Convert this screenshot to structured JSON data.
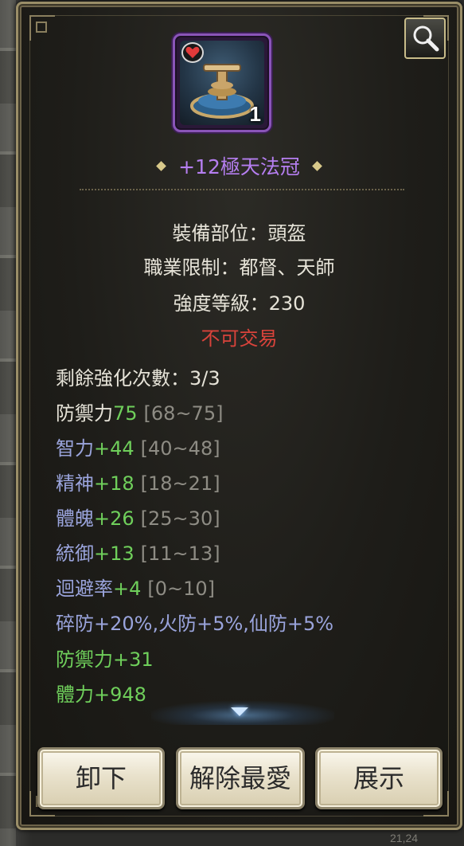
{
  "item": {
    "name": "+12極天法冠",
    "count": "1",
    "slot": "裝備部位：頭盔",
    "class_limit": "職業限制：都督、天師",
    "level": "強度等級：230",
    "trade_status": "不可交易",
    "enhance_remaining": "剩餘強化次數：3/3"
  },
  "stats": [
    {
      "label": "防禦力",
      "value": "75",
      "range": "[68~75]"
    },
    {
      "label": "智力",
      "value": "+44",
      "range": "[40~48]"
    },
    {
      "label": "精神",
      "value": "+18",
      "range": "[18~21]"
    },
    {
      "label": "體魄",
      "value": "+26",
      "range": "[25~30]"
    },
    {
      "label": "統御",
      "value": "+13",
      "range": "[11~13]"
    },
    {
      "label": "迴避率",
      "value": "+4",
      "range": "[0~10]"
    }
  ],
  "resist_line": "碎防+20%,火防+5%,仙防+5%",
  "bonus_lines": [
    "防禦力+31",
    "體力+948"
  ],
  "buttons": {
    "unequip": "卸下",
    "unfavorite": "解除最愛",
    "show": "展示"
  },
  "footer_text": "21,24",
  "colors": {
    "title": "#b57ef0",
    "untradable": "#d9433b",
    "stat_value": "#6fcf5b",
    "stat_label": "#9aa4dc"
  },
  "icons": [
    "heart-icon",
    "zoom-icon",
    "scroll-down-icon"
  ]
}
